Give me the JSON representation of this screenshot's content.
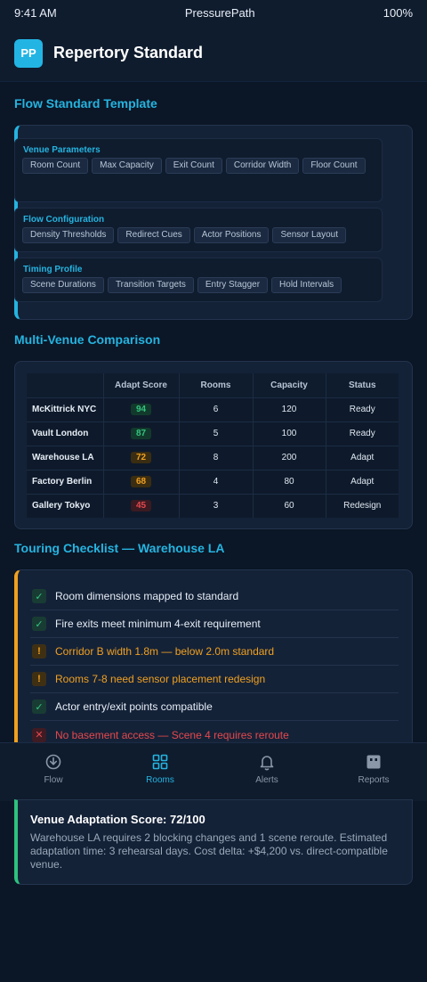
{
  "status_bar": {
    "time": "9:41 AM",
    "app": "PressurePath",
    "battery": "100%"
  },
  "header": {
    "logo": "PP",
    "title": "Repertory Standard"
  },
  "template": {
    "title": "Flow Standard Template",
    "groups": [
      {
        "title": "Venue Parameters",
        "chips": [
          "Room Count",
          "Max Capacity",
          "Exit Count",
          "Corridor Width",
          "Floor Count"
        ]
      },
      {
        "title": "Flow Configuration",
        "chips": [
          "Density Thresholds",
          "Redirect Cues",
          "Actor Positions",
          "Sensor Layout"
        ]
      },
      {
        "title": "Timing Profile",
        "chips": [
          "Scene Durations",
          "Transition Targets",
          "Entry Stagger",
          "Hold Intervals"
        ]
      }
    ]
  },
  "comparison": {
    "title": "Multi-Venue Comparison",
    "columns": [
      "",
      "Adapt Score",
      "Rooms",
      "Capacity",
      "Status"
    ],
    "rows": [
      {
        "venue": "McKittrick NYC",
        "score": "94",
        "rooms": "6",
        "capacity": "120",
        "status": "Ready"
      },
      {
        "venue": "Vault London",
        "score": "87",
        "rooms": "5",
        "capacity": "100",
        "status": "Ready"
      },
      {
        "venue": "Warehouse LA",
        "score": "72",
        "rooms": "8",
        "capacity": "200",
        "status": "Adapt"
      },
      {
        "venue": "Factory Berlin",
        "score": "68",
        "rooms": "4",
        "capacity": "80",
        "status": "Adapt"
      },
      {
        "venue": "Gallery Tokyo",
        "score": "45",
        "rooms": "3",
        "capacity": "60",
        "status": "Redesign"
      }
    ]
  },
  "checklist": {
    "title": "Touring Checklist — Warehouse LA",
    "items": [
      {
        "mark": "✓",
        "text": "Room dimensions mapped to standard"
      },
      {
        "mark": "✓",
        "text": "Fire exits meet minimum 4-exit requirement"
      },
      {
        "mark": "!",
        "text": "Corridor B width 1.8m — below 2.0m standard"
      },
      {
        "mark": "!",
        "text": "Rooms 7-8 need sensor placement redesign"
      },
      {
        "mark": "✓",
        "text": "Actor entry/exit points compatible"
      },
      {
        "mark": "✕",
        "text": "No basement access — Scene 4 requires reroute"
      }
    ]
  },
  "nav": {
    "items": [
      {
        "label": "Flow",
        "icon": "flow-icon"
      },
      {
        "label": "Rooms",
        "icon": "grid-icon"
      },
      {
        "label": "Alerts",
        "icon": "bell-icon"
      },
      {
        "label": "Reports",
        "icon": "report-icon"
      }
    ],
    "active": "Rooms"
  },
  "summary": {
    "title": "Venue Adaptation Score: 72/100",
    "body": "Warehouse LA requires 2 blocking changes and 1 scene reroute. Estimated adaptation time: 3 rehearsal days. Cost delta: +$4,200 vs. direct-compatible venue."
  },
  "colors": {
    "accent": "#25b4e0",
    "ready": "#32c47e",
    "adapt": "#f0a020",
    "redesign": "#e5484d",
    "background": "#0b1626"
  }
}
